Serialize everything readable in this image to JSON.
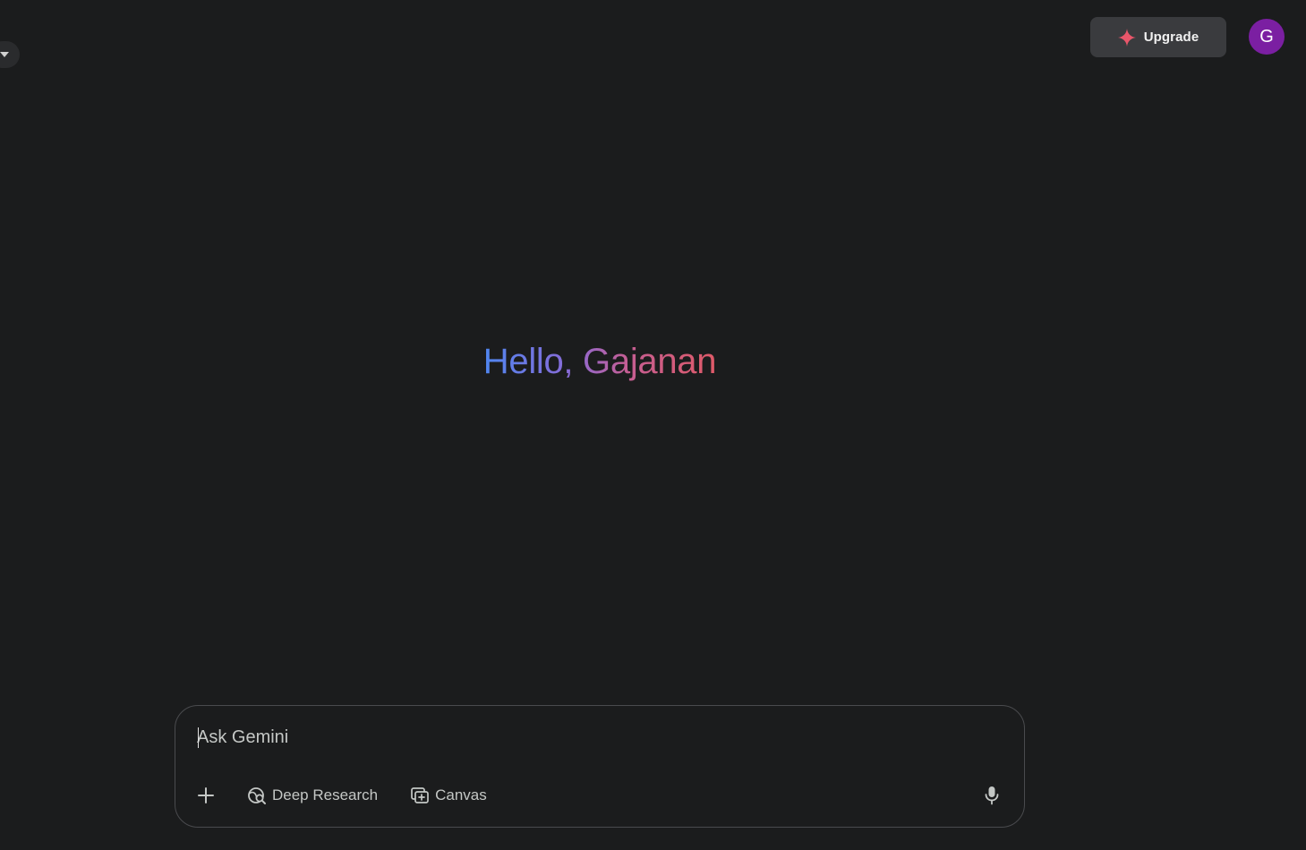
{
  "header": {
    "upgrade_label": "Upgrade",
    "avatar_initial": "G",
    "avatar_color": "#7b1fa2",
    "upgrade_icon": "sparkle-icon",
    "left_toggle_icon": "caret-down-icon"
  },
  "greeting": {
    "text": "Hello, Gajanan",
    "gradient_colors": [
      "#4f86f0",
      "#8a6ad6",
      "#c55e93",
      "#df5a68"
    ]
  },
  "composer": {
    "placeholder": "Ask Gemini",
    "value": "",
    "add_icon": "plus-icon",
    "tools": [
      {
        "label": "Deep Research",
        "icon": "deep-research-icon"
      },
      {
        "label": "Canvas",
        "icon": "canvas-icon"
      }
    ],
    "mic_icon": "microphone-icon"
  },
  "theme": {
    "background": "#1b1c1d",
    "accent_sparkle": "#e8566a"
  }
}
